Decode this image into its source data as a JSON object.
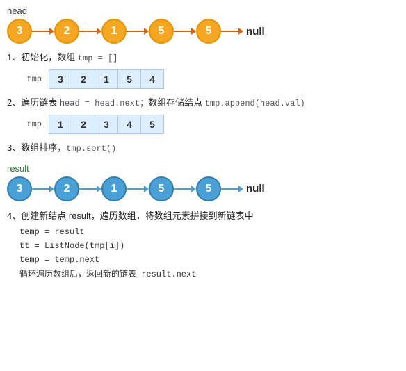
{
  "head_label": "head",
  "null_label": "null",
  "result_label": "result",
  "linked_list_orange": {
    "nodes": [
      3,
      2,
      1,
      5,
      5
    ]
  },
  "linked_list_blue": {
    "nodes": [
      3,
      2,
      1,
      5,
      5
    ]
  },
  "step1": {
    "text": "1、初始化，数组 ",
    "code": "tmp = []",
    "array": [
      3,
      2,
      1,
      5,
      4
    ],
    "label": "tmp"
  },
  "step2": {
    "text": "2、遍历链表 ",
    "code1": "head = head.next；",
    "text2": "数组存储结点 ",
    "code2": "tmp.append(head.val)",
    "array": [
      1,
      2,
      3,
      4,
      5
    ],
    "label": "tmp"
  },
  "step3": {
    "text": "3、数组排序，",
    "code": "tmp.sort()"
  },
  "step4": {
    "text": "4、创建新结点 result，遍历数组，将数组元素拼接到新链表中",
    "lines": [
      "temp = result",
      "tt = ListNode(tmp[i])",
      "temp = temp.next",
      "循环遍历数组后，返回新的链表 result.next"
    ]
  }
}
